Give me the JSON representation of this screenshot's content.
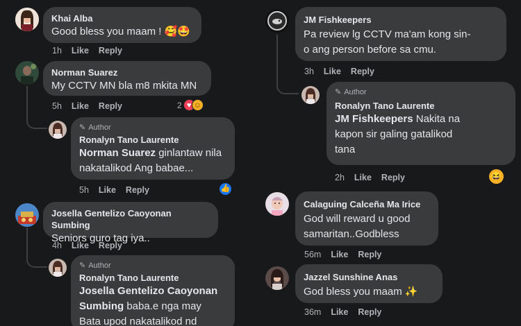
{
  "left_comments": [
    {
      "name": "Khai Alba",
      "text": "Good bless you maam !",
      "time": "1h",
      "like": "Like",
      "reply": "Reply",
      "emoji": "🥰🤩"
    },
    {
      "name": "Norman Suarez",
      "text": "My CCTV MN bla m8 mkita MN",
      "time": "5h",
      "like": "Like",
      "reply": "Reply",
      "reaction_count": "2"
    },
    {
      "author_tag": "Author",
      "name": "Ronalyn Tano Laurente",
      "mention": "Norman Suarez",
      "text_rest": " ginlantaw nila",
      "text_line2": "nakatalikod Ang babae...",
      "time": "5h",
      "like": "Like",
      "reply": "Reply"
    },
    {
      "name": "Josella Gentelizo Caoyonan Sumbing",
      "text": "Seniors guro tag iya..",
      "time": "4h",
      "like": "Like",
      "reply": "Reply"
    },
    {
      "author_tag": "Author",
      "name": "Ronalyn Tano Laurente",
      "mention_line1": "Josella Gentelizo Caoyonan",
      "mention_line2": "Sumbing",
      "text_rest": " baba.e nga may",
      "text_line3": "Bata upod nakatalikod nd"
    }
  ],
  "right_comments": [
    {
      "name": "JM Fishkeepers",
      "text_line1": "Pa review lg CCTV ma'am kong sin-",
      "text_line2": "o ang person before sa cmu.",
      "time": "3h",
      "like": "Like",
      "reply": "Reply"
    },
    {
      "author_tag": "Author",
      "name": "Ronalyn Tano Laurente",
      "mention": "JM Fishkeepers",
      "text_rest": " Nakita na",
      "text_line2": "kapon sir galing gatalikod",
      "text_line3": "tana",
      "time": "2h",
      "like": "Like",
      "reply": "Reply"
    },
    {
      "name": "Calaguing Calceña Ma Irice",
      "text_line1": "God will reward u good",
      "text_line2": "samaritan..Godbless",
      "time": "56m",
      "like": "Like",
      "reply": "Reply"
    },
    {
      "name": "Jazzel Sunshine Anas",
      "text": "God bless you maam",
      "time": "36m",
      "like": "Like",
      "reply": "Reply"
    }
  ],
  "colors": {
    "bg": "#18191a",
    "bubble": "#3a3b3c",
    "muted": "#b0b3b8",
    "like_blue": "#1877f2",
    "love_red": "#f33e58"
  }
}
